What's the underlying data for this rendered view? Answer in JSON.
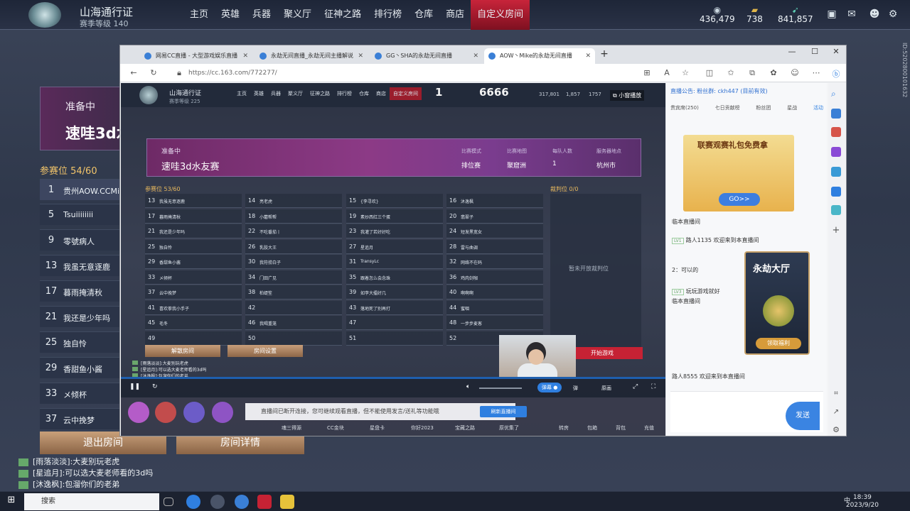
{
  "game": {
    "pass_title": "山海通行证",
    "pass_level": "赛季等级 140",
    "nav": [
      "主页",
      "英雄",
      "兵器",
      "聚义厅",
      "征神之路",
      "排行榜",
      "仓库",
      "商店",
      "自定义房间"
    ],
    "active_nav": "自定义房间",
    "resources": [
      "436,479",
      "738",
      "841,857"
    ]
  },
  "left_panel": {
    "status": "准备中",
    "room_name": "速哇3d水友赛",
    "seats_label": "参赛位 54/60",
    "rows": [
      {
        "n": "1",
        "name": "贵州AOW.CCMike"
      },
      {
        "n": "5",
        "name": "Tsuiiiiiiii"
      },
      {
        "n": "9",
        "name": "零號病人"
      },
      {
        "n": "13",
        "name": "我虽无意逐鹿"
      },
      {
        "n": "17",
        "name": "暮雨掩清秋"
      },
      {
        "n": "21",
        "name": "我还是少年吗"
      },
      {
        "n": "25",
        "name": "独自怜"
      },
      {
        "n": "29",
        "name": "香甜鱼小酱"
      },
      {
        "n": "33",
        "name": "メ倾杯"
      },
      {
        "n": "37",
        "name": "云中挽梦"
      }
    ],
    "exit_label": "退出房间",
    "details_label": "房间详情"
  },
  "chat": [
    "[雨落淡淡]:大麦别玩老虎",
    "[星追月]:可以选大麦老师看的3d吗",
    "[沐逸枫]:包溜你们的老弟"
  ],
  "taskbar": {
    "search": "搜索",
    "time": "18:39",
    "date": "2023/9/20",
    "ime": "中"
  },
  "browser": {
    "tabs": [
      "网易CC直播 - 大型游戏娱乐直播",
      "永劫无间直播_永劫无间主播解说",
      "GG丶SHA的永劫无间直播",
      "AOW丶Mike的永劫无间直播"
    ],
    "url": "https://cc.163.com/772277/"
  },
  "video": {
    "pass_title": "山海通行证",
    "pass_level": "赛季等级 225",
    "nav": [
      "主页",
      "英雄",
      "兵器",
      "聚义厅",
      "征神之路",
      "排行榜",
      "仓库",
      "商店",
      "自定义房间"
    ],
    "big1": "1",
    "big2": "6666",
    "res": [
      "317,801",
      "1,857",
      "1757"
    ],
    "mini_label": "小窗播放",
    "status": "准备中",
    "room_name": "速哇3d水友赛",
    "meta": [
      {
        "k": "比赛模式",
        "v": "排位赛"
      },
      {
        "k": "比赛地图",
        "v": "聚窟洲"
      },
      {
        "k": "每队人数",
        "v": "1"
      },
      {
        "k": "服务器地点",
        "v": "杭州市"
      }
    ],
    "seats_label": "参赛位 53/60",
    "refs_label": "裁判位 0/0",
    "refs_empty": "暂未开放裁判位",
    "grid": [
      [
        "13",
        "我虽无意逐鹿"
      ],
      [
        "14",
        "亮老虎"
      ],
      [
        "15",
        "{李寻欢}"
      ],
      [
        "16",
        "沐逸枫"
      ],
      [
        "17",
        "暮雨掩清秋"
      ],
      [
        "18",
        "小蘑帮帮"
      ],
      [
        "19",
        "素炒西红三个蛋"
      ],
      [
        "20",
        "翡翠子"
      ],
      [
        "21",
        "我还是少年吗"
      ],
      [
        "22",
        "不吃番茄丨"
      ],
      [
        "23",
        "我灌了若好好吃"
      ],
      [
        "24",
        "短发黑宽女"
      ],
      [
        "25",
        "独自怜"
      ],
      [
        "26",
        "乳胶大王"
      ],
      [
        "27",
        "星追月"
      ],
      [
        "28",
        "雷与曲调"
      ],
      [
        "29",
        "香甜鱼小酱"
      ],
      [
        "30",
        "我符捞白子"
      ],
      [
        "31",
        "TransyLc"
      ],
      [
        "32",
        "网络不在码"
      ],
      [
        "33",
        "メ倾杯"
      ],
      [
        "34",
        "门田广见"
      ],
      [
        "35",
        "跟着怎么会念珠"
      ],
      [
        "36",
        "鸡肉剑咖"
      ],
      [
        "37",
        "云中挽梦"
      ],
      [
        "38",
        "柏缇笙"
      ],
      [
        "39",
        "如李大擂好几"
      ],
      [
        "40",
        "啊啊啊"
      ],
      [
        "41",
        "喜欢拳我小手子"
      ],
      [
        "42",
        ""
      ],
      [
        "43",
        "落地死了别再打"
      ],
      [
        "44",
        "蜜咽"
      ],
      [
        "45",
        "毛冬"
      ],
      [
        "46",
        "我喝重笼"
      ],
      [
        "47",
        ""
      ],
      [
        "48",
        "一步步麦客"
      ],
      [
        "49",
        ""
      ],
      [
        "50",
        ""
      ],
      [
        "51",
        ""
      ],
      [
        "52",
        ""
      ]
    ],
    "dismiss_label": "解散房间",
    "settings_label": "房间设置",
    "start_label": "开始游戏",
    "chat": [
      "[雨落淡淡]:大麦别玩老虎",
      "[星追月]:可以选大麦老师看的3d吗",
      "[沐逸枫]:包溜你们的老弟"
    ],
    "danmu_label": "弹幕",
    "quality": "原画",
    "notice": "直播间已断开连接，您可继续观看直播，但不能使用发言/送礼等功能哦",
    "refresh_label": "刷新直播间",
    "gifts": [
      "魂三得源",
      "CC金块",
      "星盘卡",
      "你好2023",
      "宝藏之路",
      "原优集了"
    ],
    "gift_actions": [
      "转房",
      "包箱",
      "背包",
      "充值"
    ]
  },
  "room_chat": {
    "announcement": "直播公告: 粉丝群: ckh447 (目前有效)",
    "tabs": [
      "贵宾席(250)",
      "七日贡献榜",
      "粉丝团",
      "星战",
      "活动"
    ],
    "ad_title": "联赛观赛礼包免费拿",
    "ad_go": "GO>>",
    "messages": [
      {
        "lv": "",
        "text": "临本直播间"
      },
      {
        "lv": "LV1",
        "text": "路人1135 欢迎来到本直播间"
      },
      {
        "lv": "",
        "text": "2：可以的"
      },
      {
        "lv": "LV3",
        "text": "玩玩游戏就好"
      },
      {
        "lv": "",
        "text": "临本直播间"
      },
      {
        "lv": "",
        "text": "路人8555 欢迎来到本直播间"
      }
    ],
    "promo_title": "永劫大厅",
    "promo_btn": "领取福利",
    "send_label": "发送"
  }
}
